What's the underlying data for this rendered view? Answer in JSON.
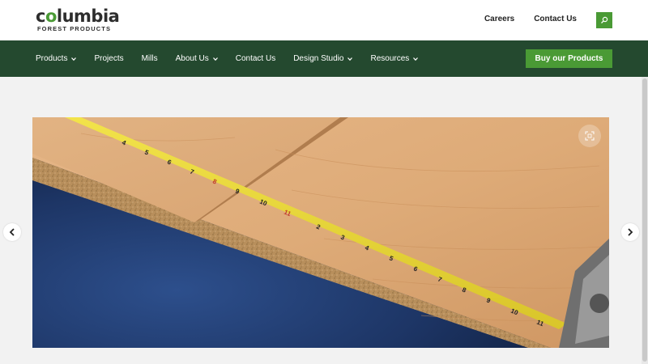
{
  "brand": {
    "name_part1": "c",
    "name_o": "o",
    "name_part2": "lumbia",
    "subtitle": "FOREST PRODUCTS",
    "green": "#4a9a35",
    "dark_green": "#24492f"
  },
  "top_links": [
    {
      "label": "Careers"
    },
    {
      "label": "Contact Us"
    }
  ],
  "search": {
    "icon": "search-icon"
  },
  "nav": {
    "items": [
      {
        "label": "Products",
        "dropdown": true
      },
      {
        "label": "Projects",
        "dropdown": false
      },
      {
        "label": "Mills",
        "dropdown": false
      },
      {
        "label": "About Us",
        "dropdown": true
      },
      {
        "label": "Contact Us",
        "dropdown": false
      },
      {
        "label": "Design Studio",
        "dropdown": true
      },
      {
        "label": "Resources",
        "dropdown": true
      }
    ],
    "cta_label": "Buy our Products"
  },
  "hero": {
    "tape_numbers_upper": [
      "4",
      "5",
      "6",
      "7",
      "8",
      "9",
      "10",
      "11"
    ],
    "tape_numbers_lower": [
      "2",
      "3",
      "4",
      "5",
      "6",
      "7",
      "8",
      "9",
      "10",
      "11"
    ]
  },
  "carousel": {
    "prev_icon": "chevron-left-icon",
    "next_icon": "chevron-right-icon",
    "expand_icon": "expand-icon"
  }
}
